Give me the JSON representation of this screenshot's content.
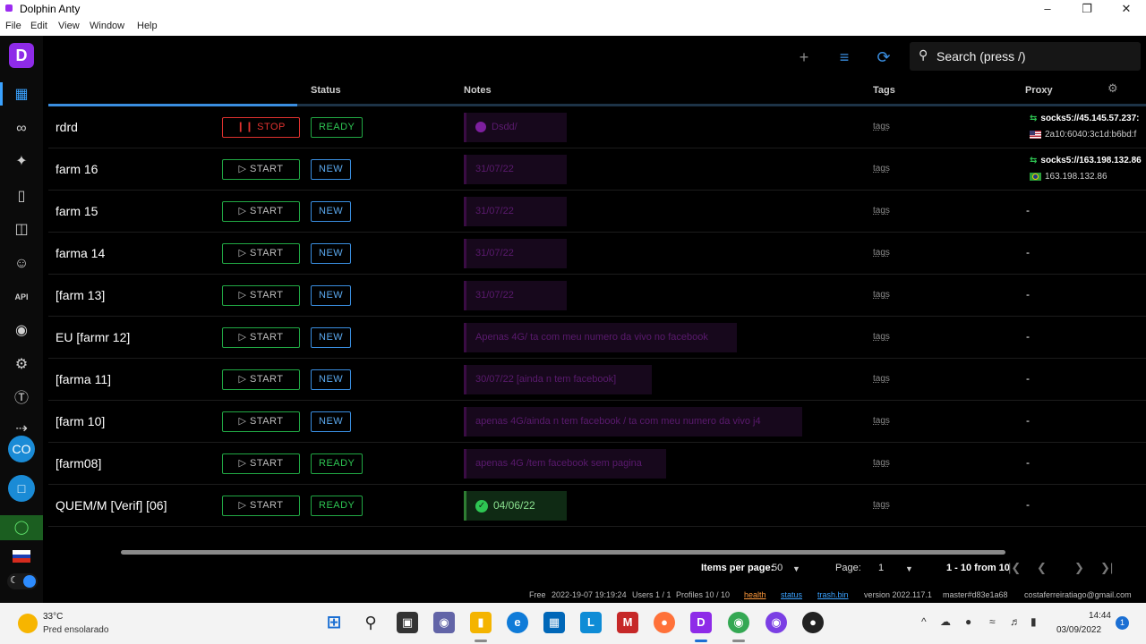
{
  "window": {
    "title": "Dolphin Anty"
  },
  "menu": [
    "File",
    "Edit",
    "View",
    "Window",
    "Help"
  ],
  "sidebar": {
    "logo": "D",
    "avatar": "CO"
  },
  "search": {
    "placeholder": "Search (press /)"
  },
  "table": {
    "columns": [
      "Status",
      "Notes",
      "Tags",
      "Proxy"
    ],
    "rows": [
      {
        "name": "rdrd",
        "action": "STOP",
        "status": "READY",
        "note": "Dsdd/",
        "tags": "tags",
        "proxy_main": "socks5://45.145.57.237:",
        "proxy_sub": "2a10:6040:3c1d:b6bd:f",
        "proxy_flag": "us"
      },
      {
        "name": "farm 16",
        "action": "START",
        "status": "NEW",
        "note": "31/07/22",
        "tags": "tags",
        "proxy_main": "socks5://163.198.132.86",
        "proxy_sub": "163.198.132.86",
        "proxy_flag": "br"
      },
      {
        "name": "farm 15",
        "action": "START",
        "status": "NEW",
        "note": "31/07/22",
        "tags": "tags",
        "proxy_main": "-"
      },
      {
        "name": "farma 14",
        "action": "START",
        "status": "NEW",
        "note": "31/07/22",
        "tags": "tags",
        "proxy_main": "-"
      },
      {
        "name": "[farm 13]",
        "action": "START",
        "status": "NEW",
        "note": "31/07/22",
        "tags": "tags",
        "proxy_main": "-"
      },
      {
        "name": "EU [farmr 12]",
        "action": "START",
        "status": "NEW",
        "note": "Apenas 4G/ ta com meu numero da vivo no facebook",
        "tags": "tags",
        "proxy_main": "-"
      },
      {
        "name": "[farma 11]",
        "action": "START",
        "status": "NEW",
        "note": "30/07/22 [ainda n tem facebook]",
        "tags": "tags",
        "proxy_main": "-"
      },
      {
        "name": "[farm 10]",
        "action": "START",
        "status": "NEW",
        "note": "apenas 4G/ainda n tem facebook / ta com meu numero da vivo j4",
        "tags": "tags",
        "proxy_main": "-"
      },
      {
        "name": "[farm08]",
        "action": "START",
        "status": "READY",
        "note": "apenas 4G /tem facebook sem pagina",
        "tags": "tags",
        "proxy_main": "-"
      },
      {
        "name": "QUEM/M [Verif] [06]",
        "action": "START",
        "status": "READY",
        "note": "04/06/22",
        "note_ok": true,
        "tags": "tags",
        "proxy_main": "-"
      }
    ]
  },
  "pagination": {
    "items_label": "Items per page:",
    "items_value": "50",
    "page_label": "Page:",
    "page_value": "1",
    "range": "1 - 10 from 10"
  },
  "footer": {
    "plan": "Free",
    "datetime": "2022-19-07 19:19:24",
    "users": "Users 1 / 1",
    "profiles": "Profiles 10 / 10",
    "health": "health",
    "status": "status",
    "trash": "trash.bin",
    "version": "version 2022.117.1",
    "master": "master#d83e1a68",
    "email": "costaferreiratiago@gmail.com"
  },
  "taskbar": {
    "temp": "33°C",
    "weather": "Pred ensolarado",
    "time": "14:44",
    "date": "03/09/2022",
    "notifications": "1"
  },
  "colors": {
    "accent": "#3a8ee0",
    "brand": "#8e2be8",
    "ready": "#2ec653",
    "stop": "#e0322f"
  }
}
